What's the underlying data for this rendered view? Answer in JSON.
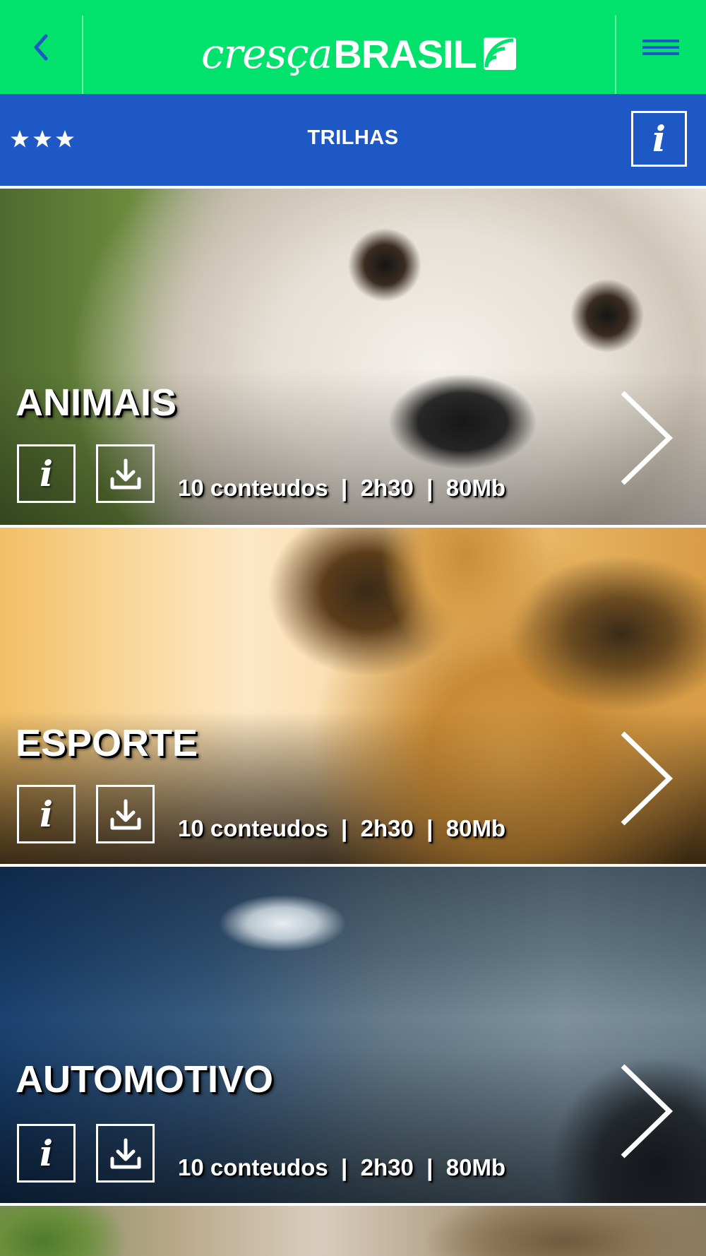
{
  "header": {
    "logo_part1": "cresça",
    "logo_part2": "BRASIL"
  },
  "subheader": {
    "title": "TRILHAS",
    "info_label": "i",
    "star_count": 3
  },
  "colors": {
    "header_bg": "#00e26c",
    "subheader_bg": "#1e58c4",
    "back_arrow": "#1e58c4"
  },
  "cards": [
    {
      "name": "ANIMAIS",
      "info_label": "i",
      "meta": "10 conteudos  |  2h30  |  80Mb"
    },
    {
      "name": "ESPORTE",
      "info_label": "i",
      "meta": "10 conteudos  |  2h30  |  80Mb"
    },
    {
      "name": "AUTOMOTIVO",
      "info_label": "i",
      "meta": "10 conteudos  |  2h30  |  80Mb"
    }
  ],
  "icons": [
    "back-chevron-icon",
    "logo-wave-icon",
    "hamburger-menu-icon",
    "star-icon",
    "info-icon",
    "download-icon",
    "chevron-right-icon"
  ]
}
